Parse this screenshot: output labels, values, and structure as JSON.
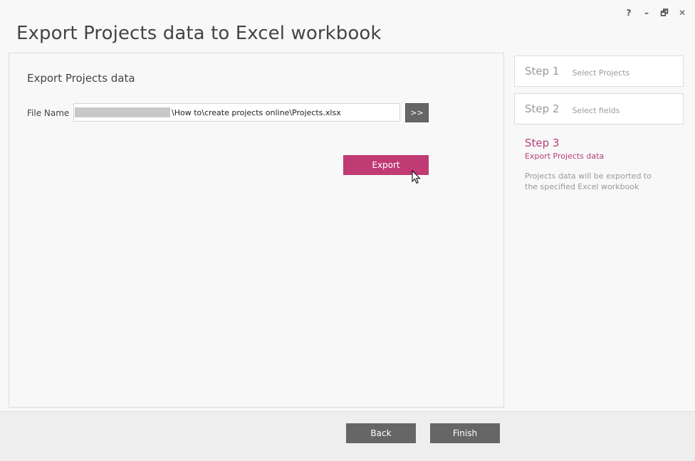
{
  "window": {
    "title": "Export Projects data to Excel workbook",
    "controls": {
      "help": "?",
      "minimize": "–",
      "restore": "🗗",
      "close": "✕"
    }
  },
  "main": {
    "section_title": "Export Projects data",
    "file_label": "File Name",
    "file_value_visible": "\\How to\\create projects online\\Projects.xlsx",
    "browse_label": ">>",
    "export_label": "Export"
  },
  "steps": [
    {
      "number": "Step 1",
      "label": "Select Projects"
    },
    {
      "number": "Step 2",
      "label": "Select fields"
    },
    {
      "number": "Step 3",
      "label": "Export Projects data",
      "note": "Projects data will be exported to the specified Excel workbook"
    }
  ],
  "footer": {
    "back_label": "Back",
    "finish_label": "Finish"
  },
  "colors": {
    "accent": "#c03a73",
    "button_dark": "#666666"
  }
}
